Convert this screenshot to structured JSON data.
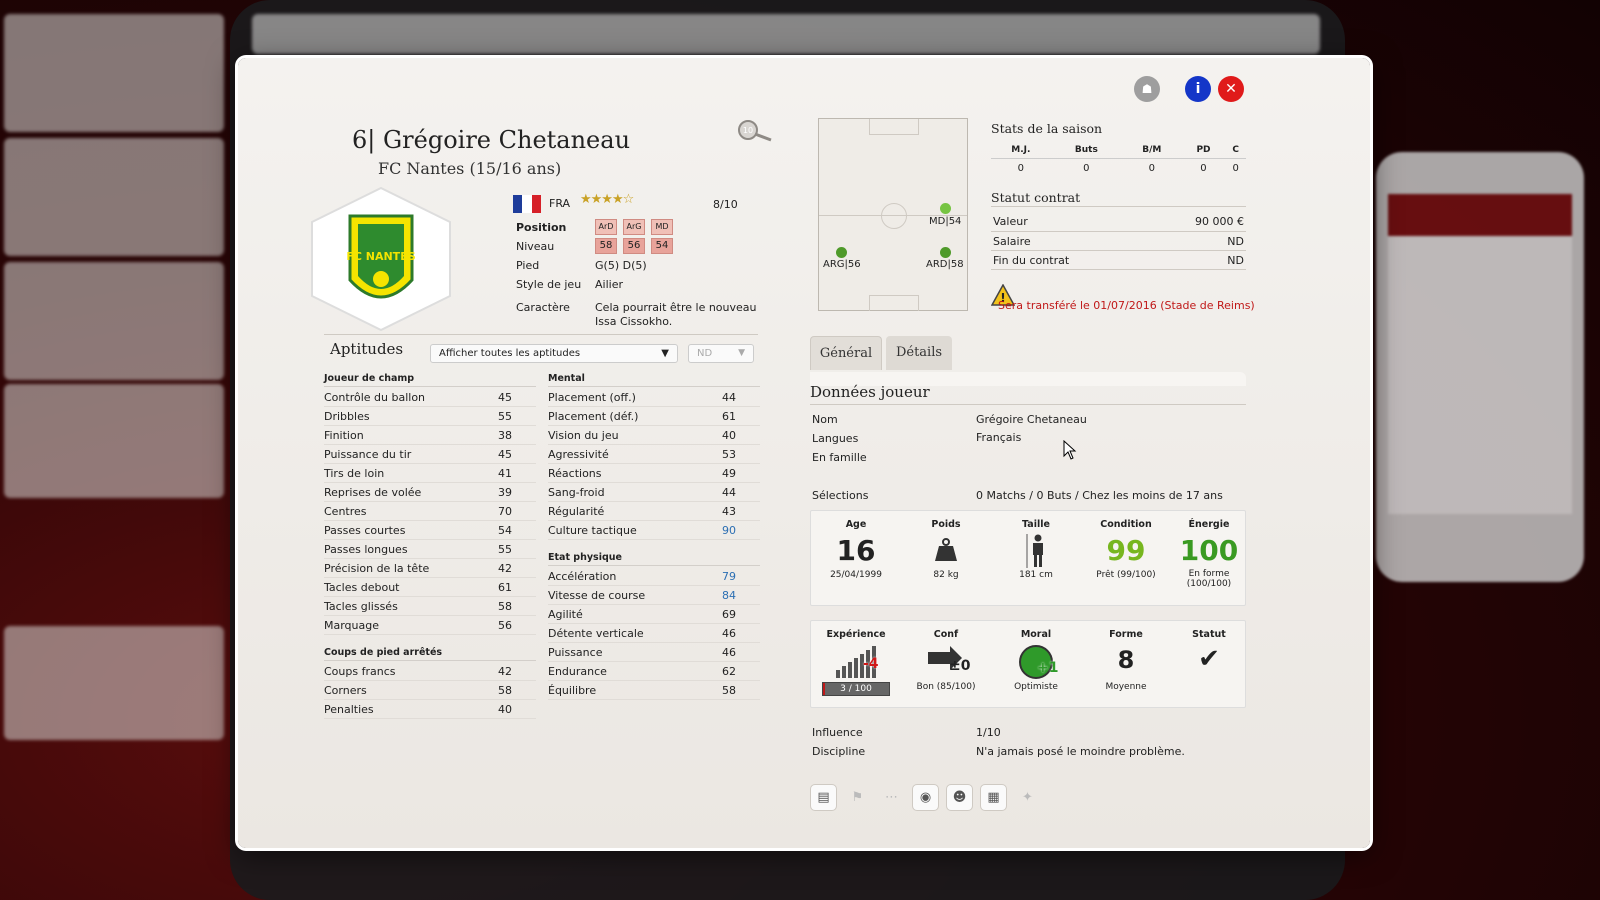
{
  "player": {
    "number_name": "6| Grégoire Chetaneau",
    "club": "FC Nantes (15/16 ans)",
    "crest_text": "FC NANTES",
    "nationality": "FRA",
    "stars": "★★★★☆",
    "rating": "8/10",
    "zoom_level": "10",
    "info": {
      "position_label": "Position",
      "positions": [
        "ArD",
        "ArG",
        "MD"
      ],
      "niveau_label": "Niveau",
      "niveaux": [
        "58",
        "56",
        "54"
      ],
      "pied_label": "Pied",
      "pied": "G(5) D(5)",
      "style_label": "Style de jeu",
      "style": "Ailier",
      "caractere_label": "Caractère",
      "caractere": "Cela pourrait être le nouveau Issa Cissokho."
    }
  },
  "aptitudes": {
    "title": "Aptitudes",
    "filter": "Afficher toutes les aptitudes",
    "filter2": "ND",
    "col1": {
      "h1": "Joueur de champ",
      "rows1": [
        {
          "k": "Contrôle du ballon",
          "v": "45"
        },
        {
          "k": "Dribbles",
          "v": "55"
        },
        {
          "k": "Finition",
          "v": "38"
        },
        {
          "k": "Puissance du tir",
          "v": "45"
        },
        {
          "k": "Tirs de loin",
          "v": "41"
        },
        {
          "k": "Reprises de volée",
          "v": "39"
        },
        {
          "k": "Centres",
          "v": "70"
        },
        {
          "k": "Passes courtes",
          "v": "54"
        },
        {
          "k": "Passes longues",
          "v": "55"
        },
        {
          "k": "Précision de la tête",
          "v": "42"
        },
        {
          "k": "Tacles debout",
          "v": "61"
        },
        {
          "k": "Tacles glissés",
          "v": "58"
        },
        {
          "k": "Marquage",
          "v": "56"
        }
      ],
      "h2": "Coups de pied arrêtés",
      "rows2": [
        {
          "k": "Coups francs",
          "v": "42"
        },
        {
          "k": "Corners",
          "v": "58"
        },
        {
          "k": "Penalties",
          "v": "40"
        }
      ]
    },
    "col2": {
      "h1": "Mental",
      "rows1": [
        {
          "k": "Placement (off.)",
          "v": "44"
        },
        {
          "k": "Placement (déf.)",
          "v": "61"
        },
        {
          "k": "Vision du jeu",
          "v": "40"
        },
        {
          "k": "Agressivité",
          "v": "53"
        },
        {
          "k": "Réactions",
          "v": "49"
        },
        {
          "k": "Sang-froid",
          "v": "44"
        },
        {
          "k": "Régularité",
          "v": "43"
        },
        {
          "k": "Culture tactique",
          "v": "90",
          "hl": true
        }
      ],
      "h2": "Etat physique",
      "rows2": [
        {
          "k": "Accélération",
          "v": "79",
          "hl": true
        },
        {
          "k": "Vitesse de course",
          "v": "84",
          "hl": true
        },
        {
          "k": "Agilité",
          "v": "69"
        },
        {
          "k": "Détente verticale",
          "v": "46"
        },
        {
          "k": "Puissance",
          "v": "46"
        },
        {
          "k": "Endurance",
          "v": "62"
        },
        {
          "k": "Équilibre",
          "v": "58"
        }
      ]
    }
  },
  "pitch": {
    "md": "MD|54",
    "arg": "ARG|56",
    "ard": "ARD|58"
  },
  "season": {
    "title": "Stats de la saison",
    "headers": [
      "M.J.",
      "Buts",
      "B/M",
      "PD",
      "C"
    ],
    "values": [
      "0",
      "0",
      "0",
      "0",
      "0"
    ]
  },
  "contract": {
    "title": "Statut contrat",
    "valeur_label": "Valeur",
    "valeur": "90 000 €",
    "salaire_label": "Salaire",
    "salaire": "ND",
    "fin_label": "Fin du contrat",
    "fin": "ND",
    "transfer": "Sera transféré le 01/07/2016 (Stade de Reims)"
  },
  "tabs": {
    "general": "Général",
    "details": "Détails"
  },
  "donnees": {
    "title": "Données joueur",
    "nom_label": "Nom",
    "nom": "Grégoire Chetaneau",
    "langues_label": "Langues",
    "langues": "Français",
    "famille_label": "En famille",
    "selections_label": "Sélections",
    "selections": "0 Matchs / 0 Buts / Chez les moins de 17 ans",
    "influence_label": "Influence",
    "influence": "1/10",
    "discipline_label": "Discipline",
    "discipline": "N'a jamais posé le moindre problème."
  },
  "physique": {
    "age_label": "Age",
    "age": "16",
    "birth": "25/04/1999",
    "poids_label": "Poids",
    "poids": "82 kg",
    "taille_label": "Taille",
    "taille": "181 cm",
    "condition_label": "Condition",
    "condition": "99",
    "condition_sub": "Prêt (99/100)",
    "energie_label": "Énergie",
    "energie": "100",
    "energie_sub": "En forme (100/100)"
  },
  "morale": {
    "exp_label": "Expérience",
    "exp_delta": "-4",
    "exp_bar": "3 / 100",
    "exp_fraction": 0.03,
    "conf_label": "Conf",
    "conf_delta": "±0",
    "conf_sub": "Bon (85/100)",
    "moral_label": "Moral",
    "moral_delta": "+1",
    "moral_sub": "Optimiste",
    "forme_label": "Forme",
    "forme": "8",
    "forme_sub": "Moyenne",
    "statut_label": "Statut",
    "statut": "✔"
  },
  "colors": {
    "accent_blue": "#1436c8",
    "close_red": "#e01a1a",
    "pill": "#e8a39a",
    "green": "#3a9a22"
  }
}
